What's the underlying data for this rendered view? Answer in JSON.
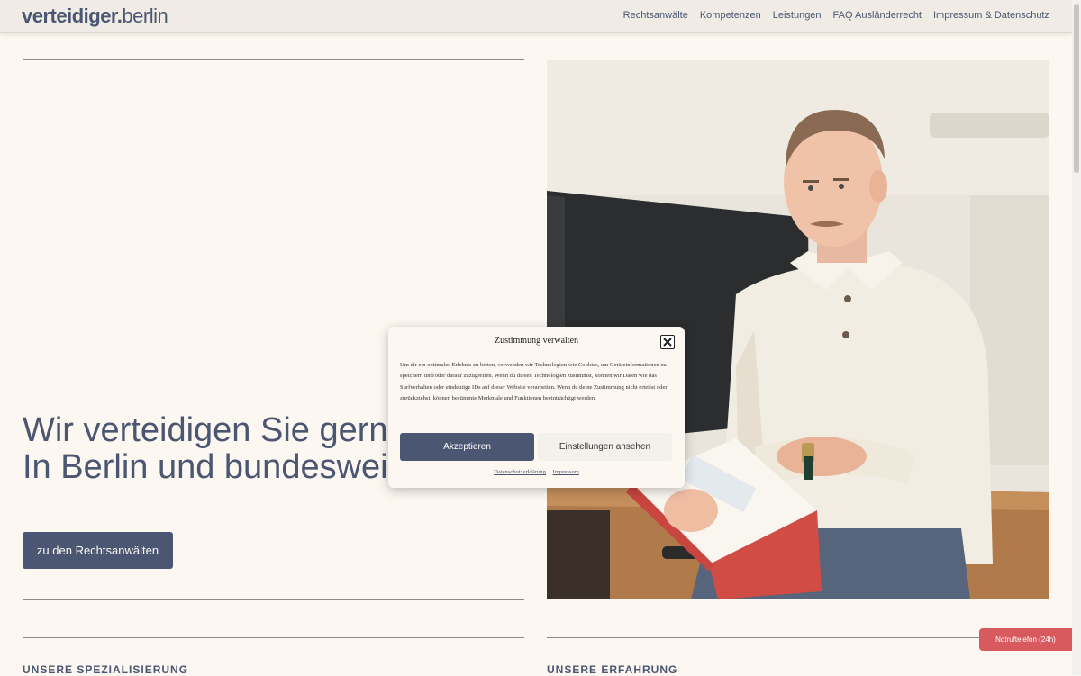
{
  "header": {
    "logo_bold": "verteidiger.",
    "logo_light": "berlin",
    "nav": [
      "Rechtsanwälte",
      "Kompetenzen",
      "Leistungen",
      "FAQ Ausländerrecht",
      "Impressum & Datenschutz"
    ]
  },
  "hero": {
    "heading_line1": "Wir verteidigen Sie gerne.",
    "heading_line2": "In Berlin und bundesweit.",
    "cta_label": "zu den Rechtsanwälten"
  },
  "sections": {
    "left_label": "UNSERE SPEZIALISIERUNG",
    "right_label": "UNSERE ERFAHRUNG"
  },
  "emergency_label": "Notruftelefon (24h)",
  "consent": {
    "title": "Zustimmung verwalten",
    "body": "Um dir ein optimales Erlebnis zu bieten, verwenden wir Technologien wie Cookies, um Geräteinformationen zu speichern und/oder darauf zuzugreifen. Wenn du diesen Technologien zustimmst, können wir Daten wie das Surfverhalten oder eindeutige IDs auf dieser Website verarbeiten. Wenn du deine Zustimmung nicht erteilst oder zurückziehst, können bestimmte Merkmale und Funktionen beeinträchtigt werden.",
    "accept_label": "Akzeptieren",
    "settings_label": "Einstellungen ansehen",
    "link_privacy": "Datenschutzerklärung",
    "link_imprint": "Impressum"
  },
  "colors": {
    "background": "#fcf7f0",
    "primary": "#4a5672",
    "emergency": "#d85a5e"
  },
  "icons": [
    "close-icon"
  ]
}
